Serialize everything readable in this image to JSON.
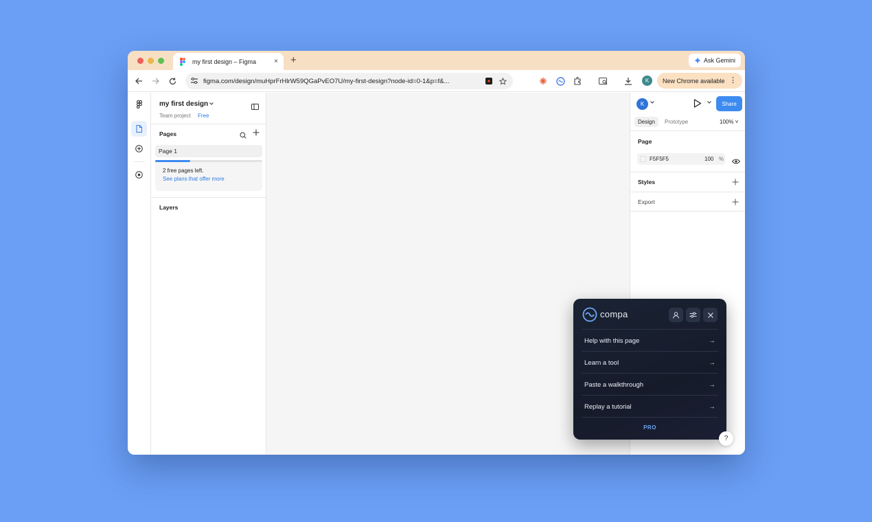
{
  "browser": {
    "tab_title": "my first design – Figma",
    "tab_close": "×",
    "new_tab": "+",
    "gemini_label": "Ask Gemini",
    "url": "figma.com/design/muHprFrHlrW59QGaPvEO7U/my-first-design?node-id=0-1&p=f&...",
    "profile_initial": "K",
    "update_label": "New Chrome available",
    "update_menu": "⋮"
  },
  "figma": {
    "file_name": "my first design",
    "team_label": "Team project",
    "plan_label": "Free",
    "pages_label": "Pages",
    "pages": [
      {
        "name": "Page 1"
      }
    ],
    "free_pages_progress": 0.33,
    "promo_text": "2 free pages left.",
    "promo_link": "See plans that offer more",
    "layers_label": "Layers",
    "user_initial": "K",
    "share_label": "Share",
    "tabs": [
      "Design",
      "Prototype"
    ],
    "zoom": "100% ˅",
    "page_section": "Page",
    "background_hex": "F5F5F5",
    "background_opacity": "100",
    "percent_sign": "%",
    "styles_label": "Styles",
    "export_label": "Export"
  },
  "compa": {
    "brand": "compa",
    "items": [
      {
        "label": "Help with this page"
      },
      {
        "label": "Learn a tool"
      },
      {
        "label": "Paste a walkthrough"
      },
      {
        "label": "Replay a tutorial"
      }
    ],
    "arrow": "→",
    "footer": "PRO"
  },
  "help_button": "?",
  "colors": {
    "desktop": "#6a9ff5",
    "accent": "#3d8bf0",
    "tab_strip": "#f7dfc4",
    "compa_bg": "#161b2a"
  }
}
